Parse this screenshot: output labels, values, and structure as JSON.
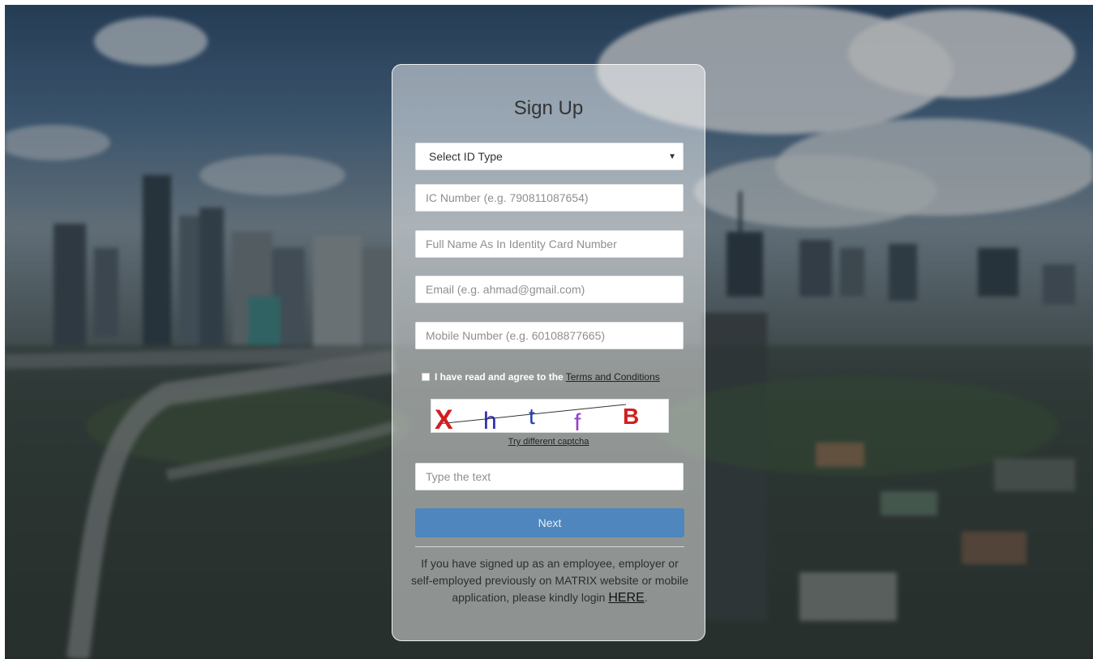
{
  "form": {
    "title": "Sign Up",
    "id_type": {
      "selected": "Select ID Type"
    },
    "ic_number_placeholder": "IC Number (e.g. 790811087654)",
    "full_name_placeholder": "Full Name As In Identity Card Number",
    "email_placeholder": "Email (e.g. ahmad@gmail.com)",
    "mobile_placeholder": "Mobile Number (e.g. 60108877665)",
    "agree_text": "I have read and agree to the",
    "terms_link": "Terms and Conditions",
    "captcha": {
      "text": "XhtfB",
      "letters": [
        "X",
        "h",
        "t",
        "f",
        "B"
      ],
      "refresh_link": "Try different captcha",
      "input_placeholder": "Type the text"
    },
    "next_label": "Next",
    "note_text": "If you have signed up as an employee, employer or self-employed previously on MATRIX website or mobile application, please kindly login",
    "note_link": "HERE",
    "note_end": "."
  },
  "colors": {
    "primary_button": "#4f86bd",
    "captcha_letters": [
      "#d11f1f",
      "#2a2aa8",
      "#1f3fb0",
      "#9a3ec9",
      "#d11f1f"
    ]
  }
}
